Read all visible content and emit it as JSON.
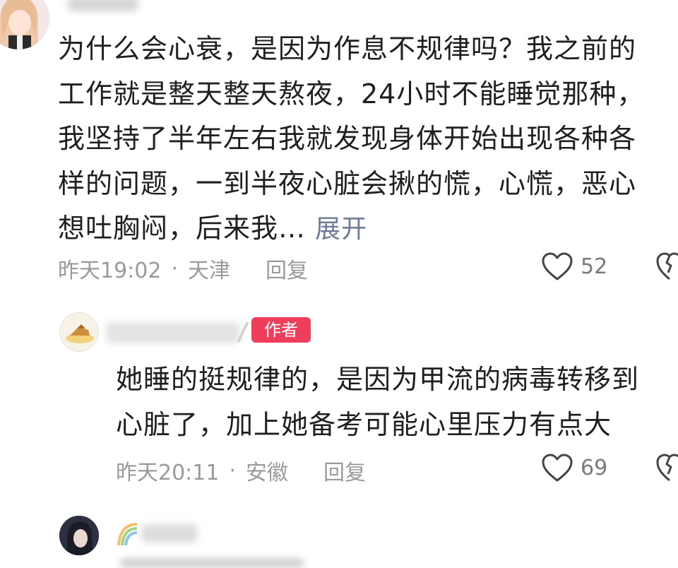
{
  "comment1": {
    "lines": [
      "为什么会心衰，是因为作息不规律吗？我之前的",
      "工作就是整天整天熬夜，24小时不能睡觉那种，",
      "我坚持了半年左右我就发现身体开始出现各种各",
      "样的问题，一到半夜心脏会揪的慌，心慌，恶心",
      "想吐胸闷，后来我…"
    ],
    "expand_label": "展开",
    "time": "昨天19:02",
    "separator": "·",
    "location": "天津",
    "reply_label": "回复",
    "likes": "52"
  },
  "reply1": {
    "author_badge": "作者",
    "lines": [
      "她睡的挺规律的，是因为甲流的病毒转移到",
      "心脏了，加上她备考可能心里压力有点大"
    ],
    "time": "昨天20:11",
    "separator": "·",
    "location": "安徽",
    "reply_label": "回复",
    "likes": "69"
  },
  "icons": {
    "like": "heart-outline-icon",
    "dislike": "broken-heart-icon"
  },
  "colors": {
    "author_badge": "#ef3e5c",
    "expand_link": "#6d7c94",
    "meta_text": "#9a9a9a"
  }
}
